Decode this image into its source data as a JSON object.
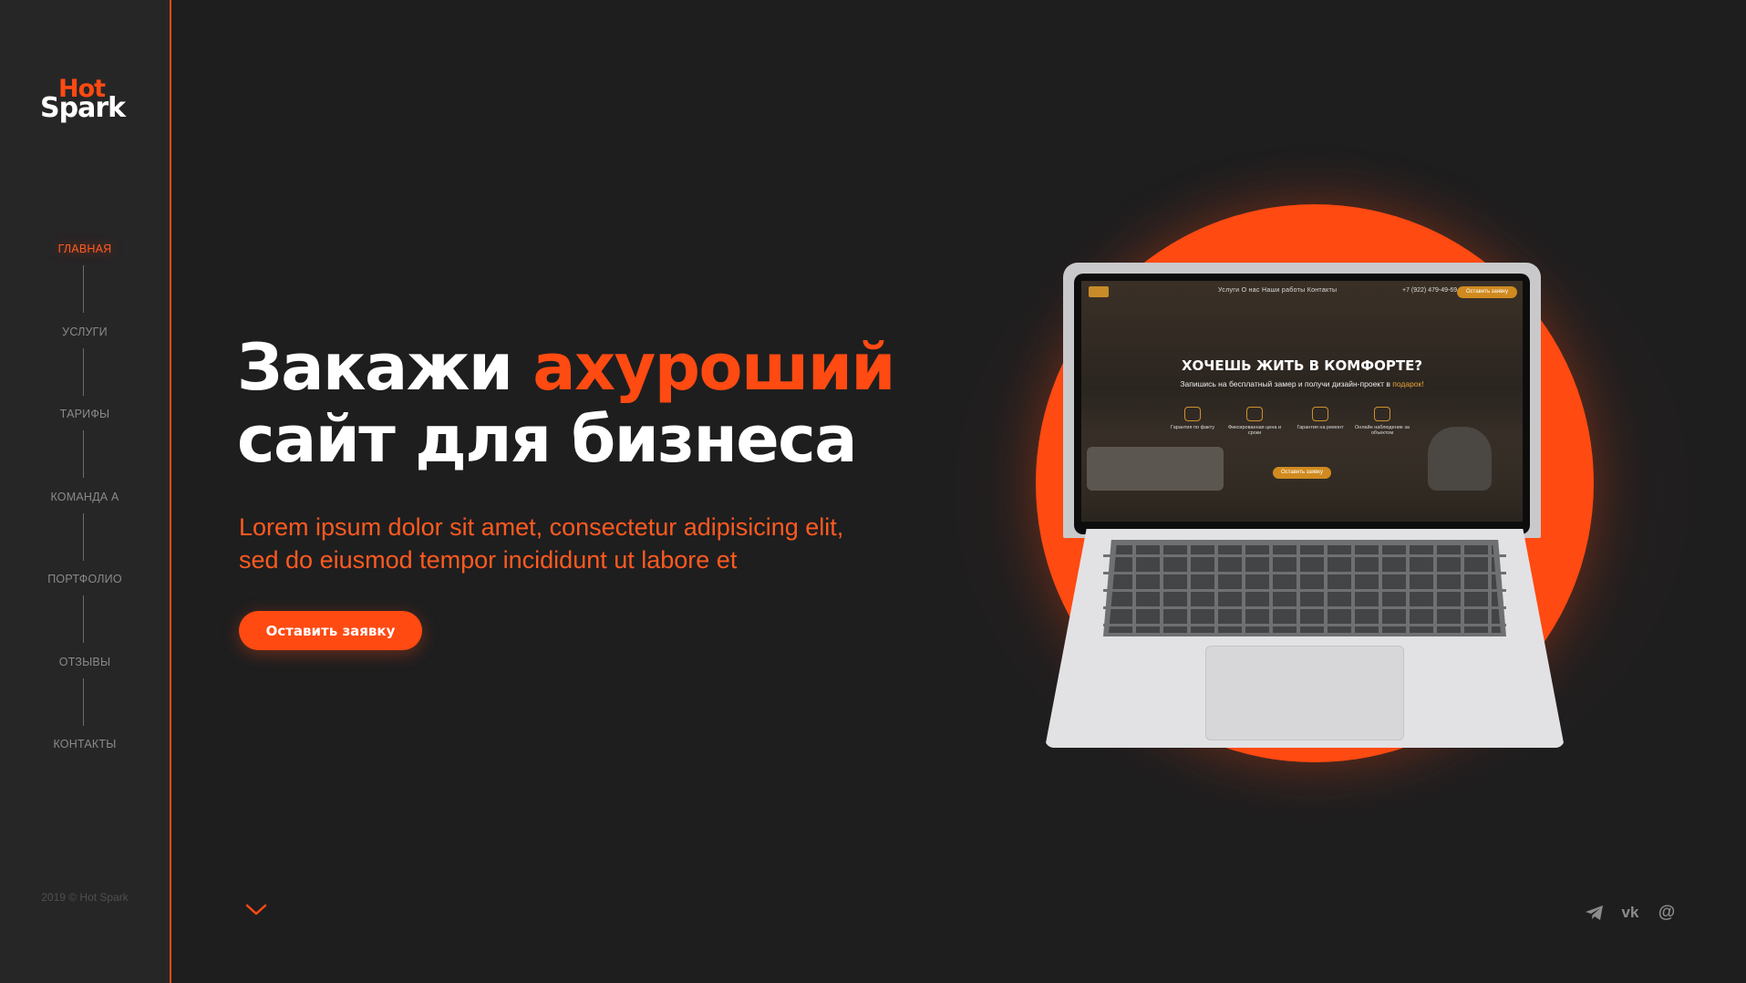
{
  "brand": {
    "logo_top": "Hot",
    "logo_bottom": "Spark"
  },
  "nav": {
    "items": [
      {
        "label": "ГЛАВНАЯ",
        "active": true
      },
      {
        "label": "УСЛУГИ"
      },
      {
        "label": "ТАРИФЫ"
      },
      {
        "label": "КОМАНДА А"
      },
      {
        "label": "ПОРТФОЛИО"
      },
      {
        "label": "ОТЗЫВЫ"
      },
      {
        "label": "КОНТАКТЫ"
      }
    ]
  },
  "copyright": "2019 © Hot Spark",
  "hero": {
    "title_line1_plain": "Закажи ",
    "title_line1_accent": "ахуроший",
    "title_line2": "сайт для бизнеса",
    "subtitle_line1": "Lorem ipsum dolor sit amet, consectetur adipisicing elit,",
    "subtitle_line2": "sed do eiusmod tempor incididunt ut labore et",
    "cta_label": "Оставить заявку"
  },
  "mockup": {
    "nav": "Услуги   О нас   Наши работы   Контакты",
    "phone": "+7 (922) 479-49-69",
    "header_button": "Оставить заявку",
    "title": "ХОЧЕШЬ ЖИТЬ В КОМФОРТЕ?",
    "subtitle_plain": "Запишись на бесплатный замер и получи дизайн-проект в ",
    "subtitle_accent": "подарок!",
    "features": [
      "Гарантия по факту",
      "Фиксированная цена и сроки",
      "Гарантия на ремонт",
      "Онлайн наблюдение за объектом"
    ],
    "cta": "Оставить заявку"
  },
  "social": {
    "icons": [
      "telegram-icon",
      "vk-icon",
      "email-icon"
    ],
    "vk_text": "vk",
    "email_text": "@"
  },
  "colors": {
    "accent": "#ff4a12",
    "background": "#1e1e1f",
    "sidebar": "#262627",
    "nav_text": "#8a8a8b"
  }
}
